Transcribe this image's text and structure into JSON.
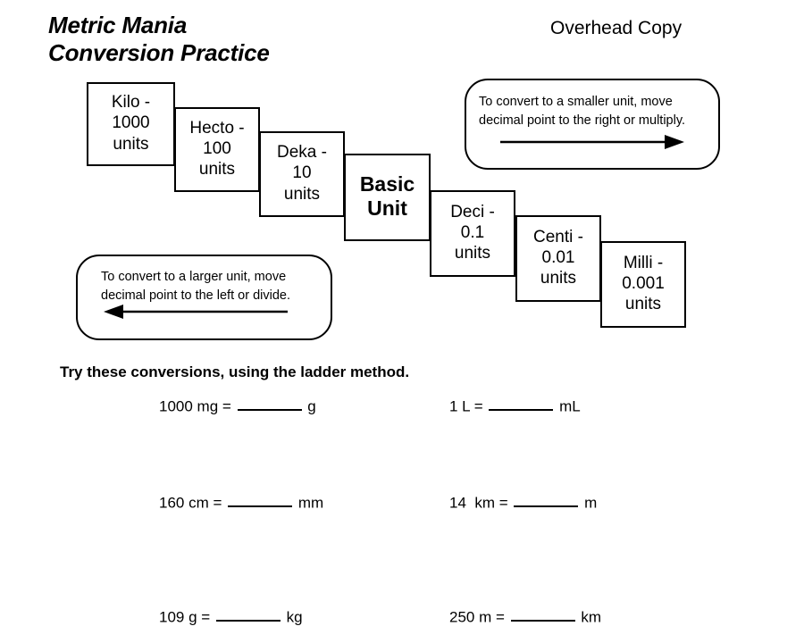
{
  "header": {
    "title": "Metric Mania\nConversion Practice",
    "note": "Overhead Copy"
  },
  "ladder": {
    "boxes": [
      {
        "name": "kilo",
        "text": "Kilo -\n1000\nunits"
      },
      {
        "name": "hecto",
        "text": "Hecto -\n100\nunits"
      },
      {
        "name": "deka",
        "text": "Deka -\n10\nunits"
      },
      {
        "name": "basic",
        "text": "Basic\nUnit"
      },
      {
        "name": "deci",
        "text": "Deci -\n0.1\nunits"
      },
      {
        "name": "centi",
        "text": "Centi -\n0.01\nunits"
      },
      {
        "name": "milli",
        "text": "Milli -\n0.001\nunits"
      }
    ]
  },
  "callouts": {
    "smaller": {
      "text": "To convert to a smaller unit, move\ndecimal  point to the right or multiply.",
      "arrow_direction": "right"
    },
    "larger": {
      "text": "To convert to a larger unit, move\ndecimal  point to the left or divide.",
      "arrow_direction": "left"
    }
  },
  "worksheet": {
    "instructions": "Try these conversions, using the ladder method.",
    "problems": [
      {
        "prefix": "1000 mg = ",
        "suffix": " g",
        "answer": ""
      },
      {
        "prefix": "1 L = ",
        "suffix": " mL",
        "answer": ""
      },
      {
        "prefix": "160 cm = ",
        "suffix": " mm",
        "answer": ""
      },
      {
        "prefix": "14  km = ",
        "suffix": " m",
        "answer": ""
      },
      {
        "prefix": "109 g = ",
        "suffix": " kg",
        "answer": ""
      },
      {
        "prefix": "250 m = ",
        "suffix": " km",
        "answer": ""
      }
    ]
  },
  "colors": {
    "ink": "#000000",
    "paper": "#ffffff"
  }
}
